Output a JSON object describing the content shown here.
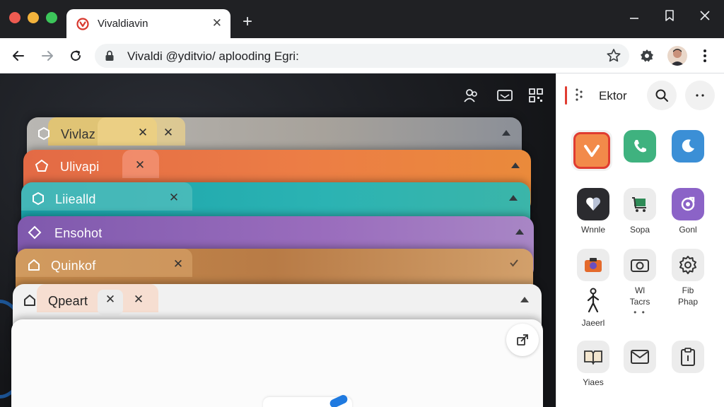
{
  "window": {
    "tab_title": "Vivaldiavin",
    "tab_close": "✕",
    "new_tab": "+"
  },
  "address_bar": {
    "url_text": "Vivaldi @yditvio/ aplooding Egri:"
  },
  "cards": [
    {
      "label": "Vivlaz",
      "close": "✕",
      "close2": "✕"
    },
    {
      "label": "Ulivapi",
      "close": "✕"
    },
    {
      "label": "Liiealld",
      "close": "✕"
    },
    {
      "label": "Ensohot"
    },
    {
      "label": "Quinkof",
      "close": "✕"
    },
    {
      "label": "Qpeart",
      "close": "✕",
      "close2": "✕"
    }
  ],
  "panel": {
    "title": "Ektor",
    "apps": [
      {
        "id": "vivaldi",
        "label": ""
      },
      {
        "id": "phone",
        "label": ""
      },
      {
        "id": "moon",
        "label": ""
      },
      {
        "id": "wallet",
        "label": "Wnnle"
      },
      {
        "id": "cart",
        "label": "Sopa"
      },
      {
        "id": "game",
        "label": "Gonl"
      },
      {
        "id": "camera",
        "label": ""
      },
      {
        "id": "camera-alt",
        "label": "Wl",
        "label2": "Tacrs",
        "dots": "• •"
      },
      {
        "id": "settings",
        "label": "Fib",
        "label2": "Phap"
      },
      {
        "id": "walker",
        "label": "Jaeerl"
      },
      {
        "id": "books",
        "label": "Yiaes"
      },
      {
        "id": "mail",
        "label": ""
      },
      {
        "id": "clipboard",
        "label": ""
      }
    ]
  },
  "colors": {
    "titlebar": "#202124",
    "vivaldi_red": "#e03c31",
    "card_orange": "#e36a45",
    "card_teal": "#1aa3aa",
    "card_purple": "#7f59ad",
    "card_brown": "#c58a4b",
    "phone_green": "#3fb27f",
    "moon_blue": "#3b8fd6"
  }
}
